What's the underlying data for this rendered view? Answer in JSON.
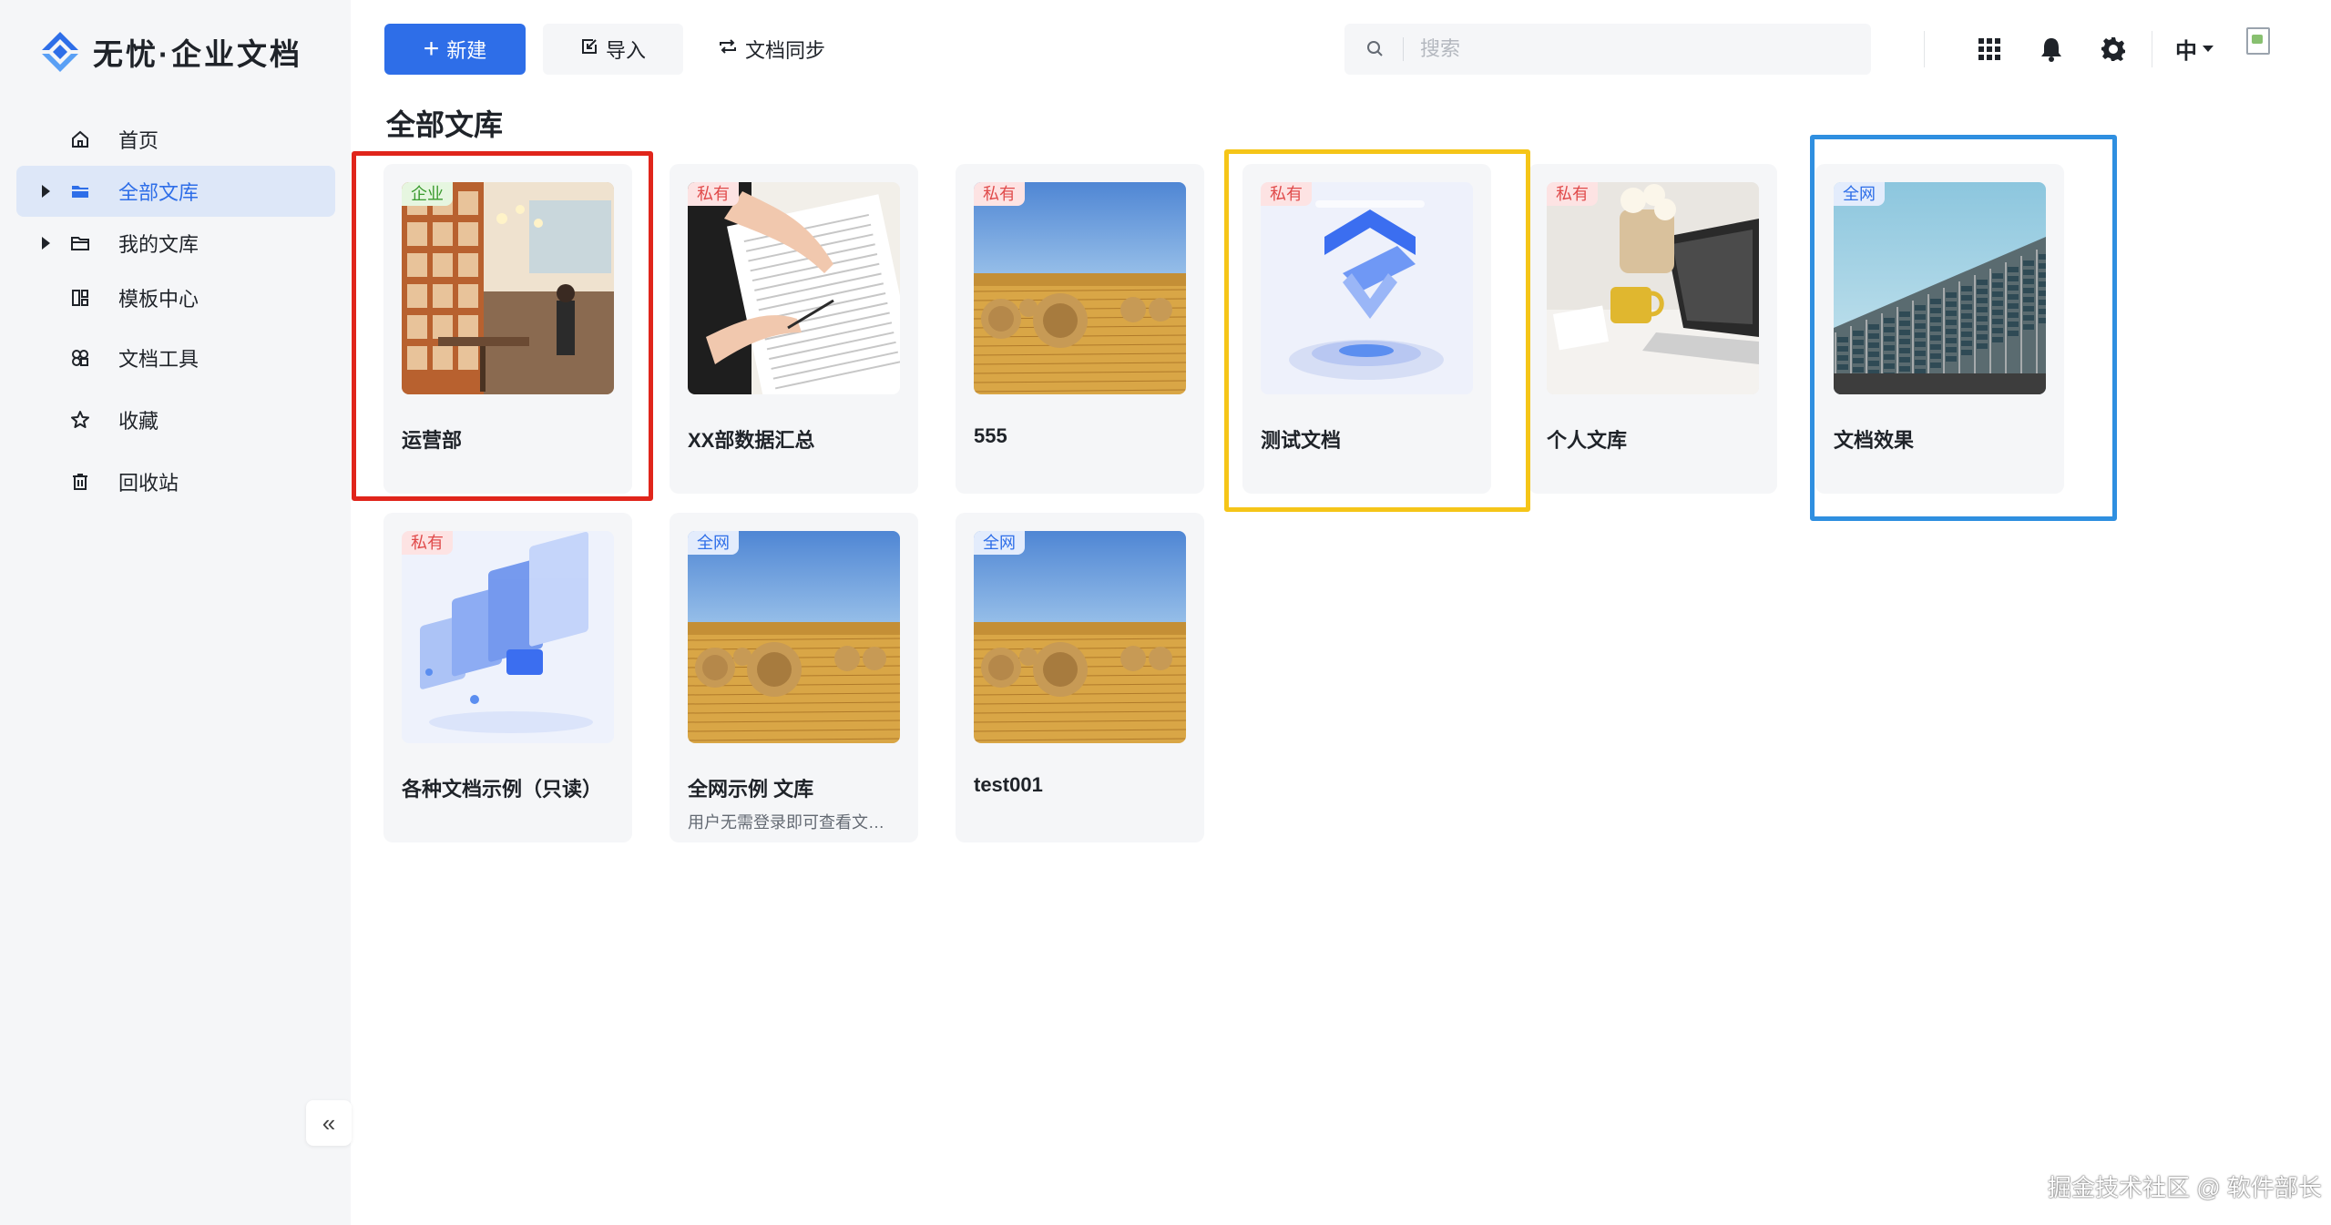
{
  "app": {
    "logo_text": "无忧·企业文档"
  },
  "sidebar": {
    "items": [
      {
        "label": "首页",
        "icon": "home-icon"
      },
      {
        "label": "全部文库",
        "icon": "folder-icon",
        "active": true,
        "expandable": true
      },
      {
        "label": "我的文库",
        "icon": "folder-outline-icon",
        "expandable": true
      },
      {
        "label": "模板中心",
        "icon": "template-icon"
      },
      {
        "label": "文档工具",
        "icon": "tools-icon"
      },
      {
        "label": "收藏",
        "icon": "star-icon"
      },
      {
        "label": "回收站",
        "icon": "trash-icon"
      }
    ],
    "collapse_label": "«"
  },
  "toolbar": {
    "new_label": "新建",
    "import_label": "导入",
    "sync_label": "文档同步",
    "search_placeholder": "搜索",
    "language_label": "中"
  },
  "colors": {
    "accent": "#2e6ee8",
    "highlight_red": "#e0251b",
    "highlight_yellow": "#f5c518",
    "highlight_blue": "#2f8fe0"
  },
  "main": {
    "title": "全部文库",
    "libraries": [
      {
        "badge": "企业",
        "badge_type": "enterprise",
        "title": "运营部",
        "desc": "",
        "image": "cafe-interior"
      },
      {
        "badge": "私有",
        "badge_type": "private",
        "title": "XX部数据汇总",
        "desc": "",
        "image": "hand-writing"
      },
      {
        "badge": "私有",
        "badge_type": "private",
        "title": "555",
        "desc": "",
        "image": "hay-field"
      },
      {
        "badge": "私有",
        "badge_type": "private",
        "title": "测试文档",
        "desc": "",
        "image": "3d-logo"
      },
      {
        "badge": "私有",
        "badge_type": "private",
        "title": "个人文库",
        "desc": "",
        "image": "desk-laptop"
      },
      {
        "badge": "全网",
        "badge_type": "public",
        "title": "文档效果",
        "desc": "",
        "image": "building"
      },
      {
        "badge": "私有",
        "badge_type": "private",
        "title": "各种文档示例（只读）",
        "desc": "",
        "image": "3d-screens"
      },
      {
        "badge": "全网",
        "badge_type": "public",
        "title": "全网示例 文库",
        "desc": "用户无需登录即可查看文…",
        "image": "hay-field"
      },
      {
        "badge": "全网",
        "badge_type": "public",
        "title": "test001",
        "desc": "",
        "image": "hay-field"
      }
    ]
  },
  "watermark": "掘金技术社区 @ 软件部长"
}
